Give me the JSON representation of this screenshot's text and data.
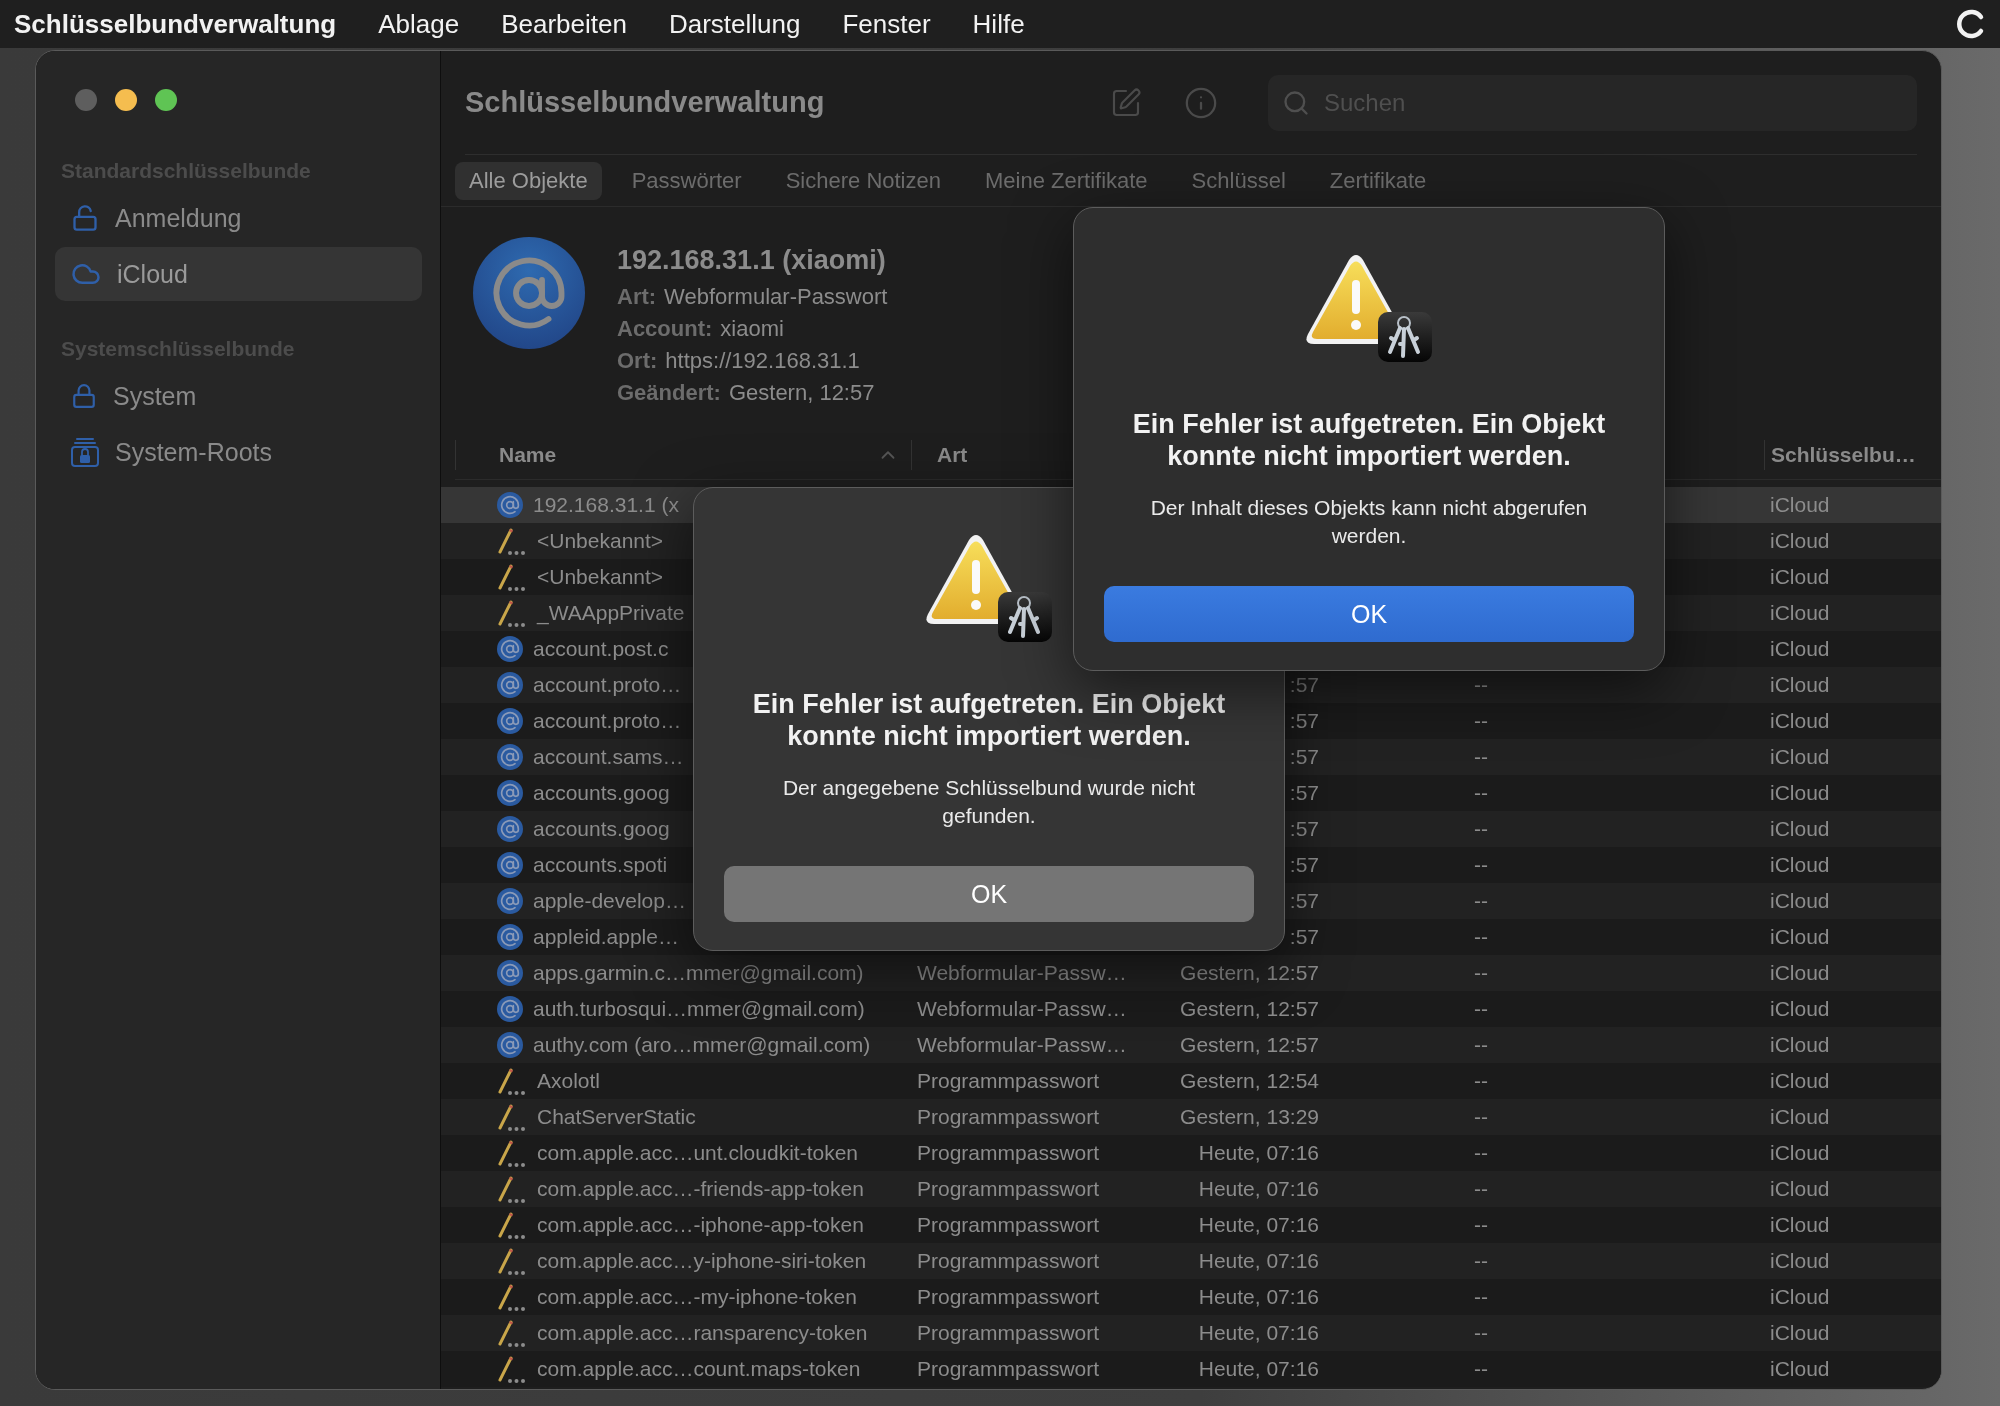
{
  "menu_bar": {
    "app_name": "Schlüsselbundverwaltung",
    "items": [
      "Ablage",
      "Bearbeiten",
      "Darstellung",
      "Fenster",
      "Hilfe"
    ]
  },
  "window": {
    "title": "Schlüsselbundverwaltung",
    "search": {
      "placeholder": "Suchen"
    }
  },
  "sidebar": {
    "sections": [
      {
        "heading": "Standardschlüsselbunde",
        "items": [
          {
            "label": "Anmeldung",
            "kind": "unlocked",
            "selected": false
          },
          {
            "label": "iCloud",
            "kind": "cloud",
            "selected": true
          }
        ]
      },
      {
        "heading": "Systemschlüsselbunde",
        "items": [
          {
            "label": "System",
            "kind": "locked",
            "selected": false
          },
          {
            "label": "System-Roots",
            "kind": "roots",
            "selected": false
          }
        ]
      }
    ]
  },
  "tabs": [
    {
      "label": "Alle Objekte",
      "selected": true
    },
    {
      "label": "Passwörter",
      "selected": false
    },
    {
      "label": "Sichere Notizen",
      "selected": false
    },
    {
      "label": "Meine Zertifikate",
      "selected": false
    },
    {
      "label": "Schlüssel",
      "selected": false
    },
    {
      "label": "Zertifikate",
      "selected": false
    }
  ],
  "detail": {
    "title": "192.168.31.1 (xiaomi)",
    "fields": [
      {
        "label": "Art:",
        "value": "Webformular-Passwort"
      },
      {
        "label": "Account:",
        "value": "xiaomi"
      },
      {
        "label": "Ort:",
        "value": "https://192.168.31.1"
      },
      {
        "label": "Geändert:",
        "value": "Gestern, 12:57"
      }
    ]
  },
  "table": {
    "columns": {
      "name": {
        "label": "Name",
        "sorted": true
      },
      "type": {
        "label": "Art"
      },
      "keychain": {
        "label": "Schlüsselbu…"
      }
    },
    "rows": [
      {
        "kind": "web",
        "name": "192.168.31.1 (x",
        "keychain": "iCloud",
        "selected": true
      },
      {
        "kind": "app",
        "name": "<Unbekannt>",
        "keychain": "iCloud",
        "selected": false
      },
      {
        "kind": "app",
        "name": "<Unbekannt>",
        "keychain": "iCloud",
        "selected": false
      },
      {
        "kind": "app",
        "name": "_WAAppPrivate",
        "keychain": "iCloud",
        "selected": false
      },
      {
        "kind": "web",
        "name": "account.post.c",
        "keychain": "iCloud",
        "selected": false
      },
      {
        "kind": "web",
        "name": "account.proto…",
        "date": ":57",
        "column_4": "--",
        "keychain": "iCloud",
        "selected": false
      },
      {
        "kind": "web",
        "name": "account.proto…",
        "date": ":57",
        "column_4": "--",
        "keychain": "iCloud",
        "selected": false
      },
      {
        "kind": "web",
        "name": "account.sams…",
        "date": ":57",
        "column_4": "--",
        "keychain": "iCloud",
        "selected": false
      },
      {
        "kind": "web",
        "name": "accounts.goog",
        "date": ":57",
        "column_4": "--",
        "keychain": "iCloud",
        "selected": false
      },
      {
        "kind": "web",
        "name": "accounts.goog",
        "date": ":57",
        "column_4": "--",
        "keychain": "iCloud",
        "selected": false
      },
      {
        "kind": "web",
        "name": "accounts.spoti",
        "date": ":57",
        "column_4": "--",
        "keychain": "iCloud",
        "selected": false
      },
      {
        "kind": "web",
        "name": "apple-develop…",
        "date": ":57",
        "column_4": "--",
        "keychain": "iCloud",
        "selected": false
      },
      {
        "kind": "web",
        "name": "appleid.apple…",
        "date": ":57",
        "column_4": "--",
        "keychain": "iCloud",
        "selected": false
      },
      {
        "kind": "web",
        "name": "apps.garmin.c…mmer@gmail.com)",
        "type": "Webformular-Passw…",
        "date": "Gestern, 12:57",
        "column_4": "--",
        "keychain": "iCloud",
        "selected": false
      },
      {
        "kind": "web",
        "name": "auth.turbosqui…mmer@gmail.com)",
        "type": "Webformular-Passw…",
        "date": "Gestern, 12:57",
        "column_4": "--",
        "keychain": "iCloud",
        "selected": false
      },
      {
        "kind": "web",
        "name": "authy.com (aro…mmer@gmail.com)",
        "type": "Webformular-Passw…",
        "date": "Gestern, 12:57",
        "column_4": "--",
        "keychain": "iCloud",
        "selected": false
      },
      {
        "kind": "app",
        "name": "Axolotl",
        "type": "Programmpasswort",
        "date": "Gestern, 12:54",
        "column_4": "--",
        "keychain": "iCloud",
        "selected": false
      },
      {
        "kind": "app",
        "name": "ChatServerStatic",
        "type": "Programmpasswort",
        "date": "Gestern, 13:29",
        "column_4": "--",
        "keychain": "iCloud",
        "selected": false
      },
      {
        "kind": "app",
        "name": "com.apple.acc…unt.cloudkit-token",
        "type": "Programmpasswort",
        "date": "Heute, 07:16",
        "column_4": "--",
        "keychain": "iCloud",
        "selected": false
      },
      {
        "kind": "app",
        "name": "com.apple.acc…-friends-app-token",
        "type": "Programmpasswort",
        "date": "Heute, 07:16",
        "column_4": "--",
        "keychain": "iCloud",
        "selected": false
      },
      {
        "kind": "app",
        "name": "com.apple.acc…-iphone-app-token",
        "type": "Programmpasswort",
        "date": "Heute, 07:16",
        "column_4": "--",
        "keychain": "iCloud",
        "selected": false
      },
      {
        "kind": "app",
        "name": "com.apple.acc…y-iphone-siri-token",
        "type": "Programmpasswort",
        "date": "Heute, 07:16",
        "column_4": "--",
        "keychain": "iCloud",
        "selected": false
      },
      {
        "kind": "app",
        "name": "com.apple.acc…-my-iphone-token",
        "type": "Programmpasswort",
        "date": "Heute, 07:16",
        "column_4": "--",
        "keychain": "iCloud",
        "selected": false
      },
      {
        "kind": "app",
        "name": "com.apple.acc…ransparency-token",
        "type": "Programmpasswort",
        "date": "Heute, 07:16",
        "column_4": "--",
        "keychain": "iCloud",
        "selected": false
      },
      {
        "kind": "app",
        "name": "com.apple.acc…count.maps-token",
        "type": "Programmpasswort",
        "date": "Heute, 07:16",
        "column_4": "--",
        "keychain": "iCloud",
        "selected": false
      }
    ]
  },
  "dialogs": [
    {
      "title": "Ein Fehler ist aufgetreten. Ein Objekt konnte nicht importiert werden.",
      "message": "Der Inhalt dieses Objekts kann nicht abgerufen werden.",
      "button": "OK",
      "active": true
    },
    {
      "title": "Ein Fehler ist aufgetreten. Ein Objekt konnte nicht importiert werden.",
      "message": "Der angegebene Schlüsselbund wurde nicht gefunden.",
      "button": "OK",
      "active": false
    }
  ]
}
